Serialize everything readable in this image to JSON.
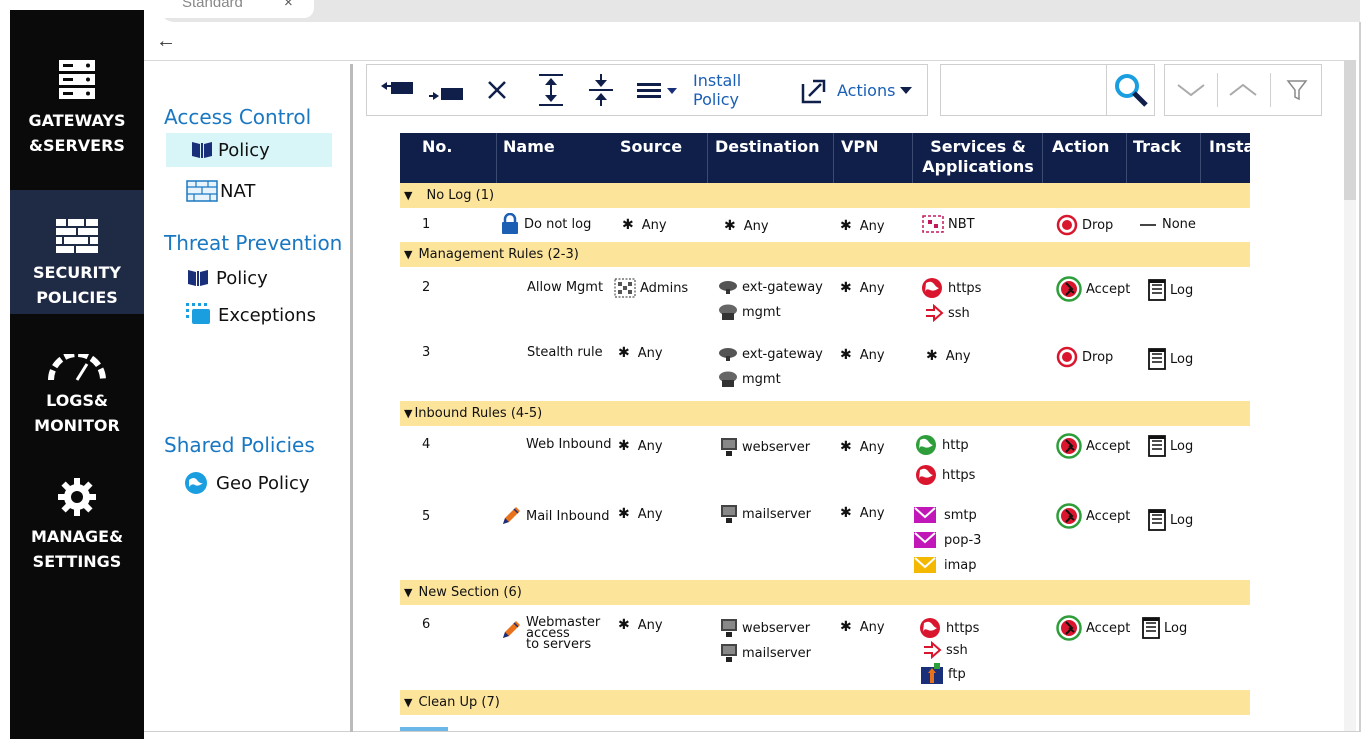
{
  "tab": {
    "title": "Standard",
    "close": "×"
  },
  "leftnav": {
    "items": [
      {
        "line1": "GATEWAYS",
        "line2": "&SERVERS",
        "icon": "servers-icon"
      },
      {
        "line1": "SECURITY",
        "line2": "POLICIES",
        "icon": "firewall-icon",
        "active": true
      },
      {
        "line1": "LOGS&",
        "line2": "MONITOR",
        "icon": "gauge-icon"
      },
      {
        "line1": "MANAGE&",
        "line2": "SETTINGS",
        "icon": "gear-icon"
      }
    ]
  },
  "policy_panel": {
    "access_control": {
      "title": "Access Control",
      "items": [
        "Policy",
        "NAT"
      ]
    },
    "threat_prevention": {
      "title": "Threat Prevention",
      "items": [
        "Policy",
        "Exceptions"
      ]
    },
    "shared_policies": {
      "title": "Shared Policies",
      "items": [
        "Geo Policy"
      ]
    }
  },
  "toolbar": {
    "install_policy": "Install Policy",
    "actions": "Actions"
  },
  "search": {
    "placeholder": ""
  },
  "grid": {
    "columns": [
      "No.",
      "Name",
      "Source",
      "Destination",
      "VPN",
      "Services &",
      "Applications",
      "Action",
      "Track",
      "Insta"
    ],
    "sections": [
      {
        "label": "No Log (1)"
      },
      {
        "label": "Management Rules (2-3)"
      },
      {
        "label": "Inbound Rules (4-5)"
      },
      {
        "label": "New Section (6)"
      },
      {
        "label": "Clean Up (7)"
      }
    ],
    "rules": [
      {
        "no": "1",
        "name": "Do not log",
        "source": [
          "Any"
        ],
        "destination": [
          "Any"
        ],
        "vpn": "Any",
        "services": [
          "NBT"
        ],
        "action": "Drop",
        "track": "None"
      },
      {
        "no": "2",
        "name": "Allow Mgmt",
        "source": [
          "Admins"
        ],
        "destination": [
          "ext-gateway",
          "mgmt"
        ],
        "vpn": "Any",
        "services": [
          "https",
          "ssh"
        ],
        "action": "Accept",
        "track": "Log"
      },
      {
        "no": "3",
        "name": "Stealth rule",
        "source": [
          "Any"
        ],
        "destination": [
          "ext-gateway",
          "mgmt"
        ],
        "vpn": "Any",
        "services": [
          "Any"
        ],
        "action": "Drop",
        "track": "Log"
      },
      {
        "no": "4",
        "name": "Web Inbound",
        "source": [
          "Any"
        ],
        "destination": [
          "webserver"
        ],
        "vpn": "Any",
        "services": [
          "http",
          "https"
        ],
        "action": "Accept",
        "track": "Log"
      },
      {
        "no": "5",
        "name": "Mail Inbound",
        "source": [
          "Any"
        ],
        "destination": [
          "mailserver"
        ],
        "vpn": "Any",
        "services": [
          "smtp",
          "pop-3",
          "imap"
        ],
        "action": "Accept",
        "track": "Log"
      },
      {
        "no": "6",
        "name_lines": [
          "Webmaster",
          "access",
          "to servers"
        ],
        "source": [
          "Any"
        ],
        "destination": [
          "webserver",
          "mailserver"
        ],
        "vpn": "Any",
        "services": [
          "https",
          "ssh",
          "ftp"
        ],
        "action": "Accept",
        "track": "Log"
      }
    ]
  },
  "colors": {
    "nav_bg": "#0a0a0a",
    "nav_active": "#1f2a45",
    "grid_header": "#0f1f4a",
    "section_bg": "#fde49b",
    "accent_blue": "#1a78c2",
    "drop_red": "#d9162d",
    "accept_green": "#2e9e3a"
  }
}
